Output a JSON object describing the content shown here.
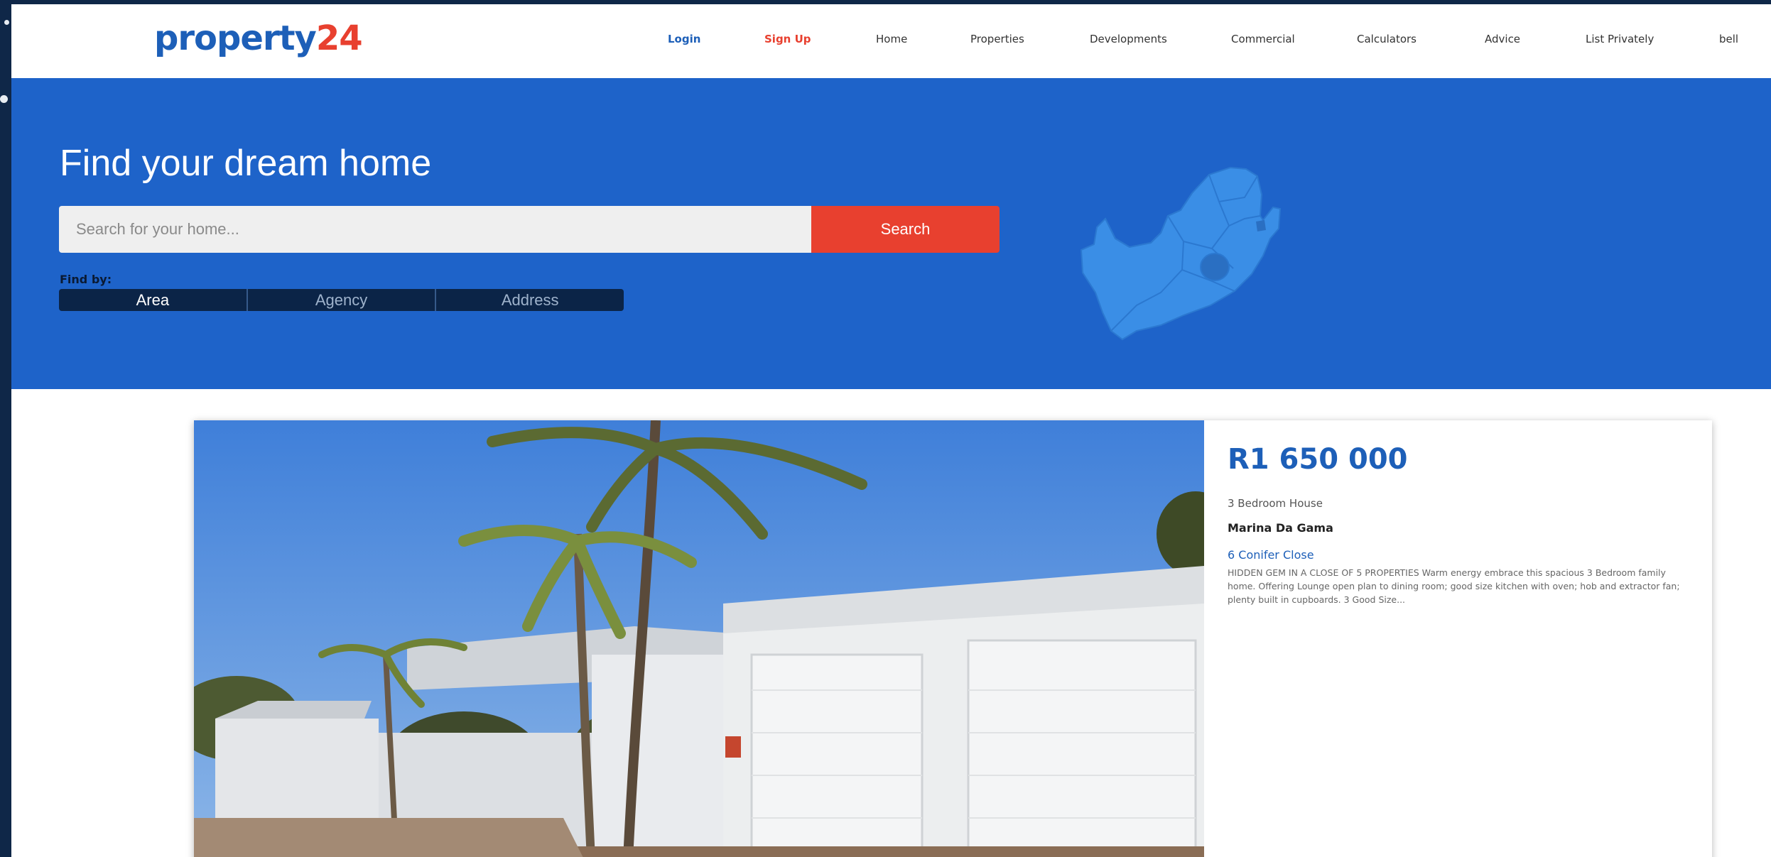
{
  "header": {
    "logo_main": "property",
    "logo_accent": "24",
    "nav": {
      "login": "Login",
      "signup": "Sign Up",
      "home": "Home",
      "properties": "Properties",
      "developments": "Developments",
      "commercial": "Commercial",
      "calculators": "Calculators",
      "advice": "Advice",
      "list_privately": "List Privately",
      "bell": "bell"
    }
  },
  "hero": {
    "title": "Find your dream home",
    "search_placeholder": "Search for your home...",
    "search_button": "Search",
    "find_by_label": "Find by:",
    "find_by_tabs": [
      "Area",
      "Agency",
      "Address"
    ],
    "active_tab": "Area",
    "map_icon": "south-africa-map-icon"
  },
  "listing": {
    "price": "R1 650 000",
    "type": "3 Bedroom House",
    "suburb": "Marina Da Gama",
    "address": "6 Conifer Close",
    "description": "HIDDEN GEM IN A CLOSE OF 5 PROPERTIES Warm energy embrace this spacious 3 Bedroom family home. Offering Lounge open plan to dining room; good size kitchen with oven; hob and extractor fan; plenty built in cupboards. 3 Good Size..."
  },
  "colors": {
    "brand_blue": "#1d5fb8",
    "accent_red": "#e8402f",
    "hero_blue": "#1e63c9",
    "tab_navy": "#0b2447"
  }
}
